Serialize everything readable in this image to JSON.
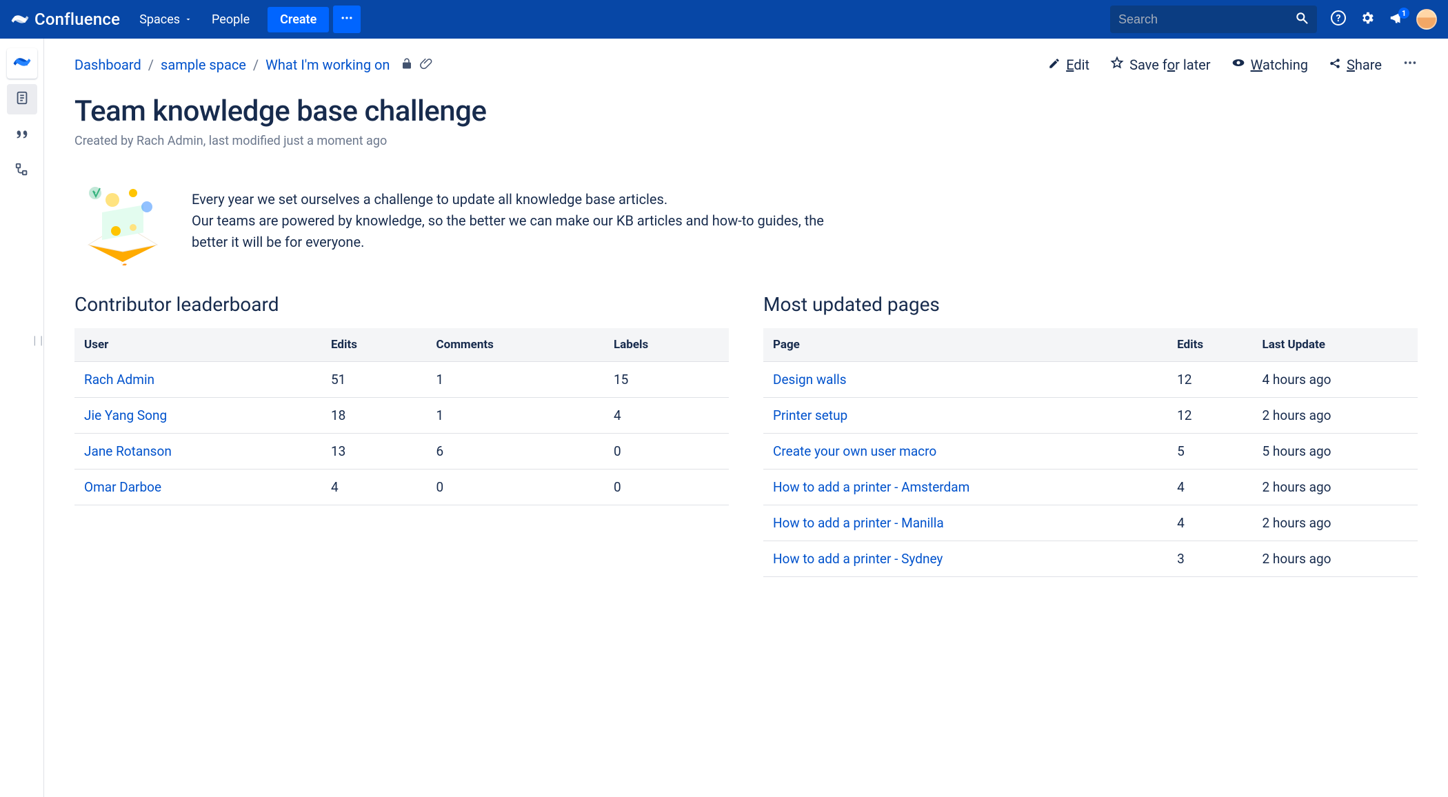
{
  "header": {
    "product": "Confluence",
    "nav": {
      "spaces": "Spaces",
      "people": "People"
    },
    "create": "Create",
    "search_placeholder": "Search",
    "notif_count": "1"
  },
  "breadcrumb": {
    "items": [
      "Dashboard",
      "sample space",
      "What I'm working on"
    ]
  },
  "page_actions": {
    "edit": "Edit",
    "save": "Save for later",
    "watching": "Watching",
    "share": "Share"
  },
  "page": {
    "title": "Team knowledge base challenge",
    "byline": "Created by Rach Admin, last modified just a moment ago",
    "intro_l1": "Every year we set ourselves a challenge to update all knowledge base articles.",
    "intro_l2": "Our teams are powered by knowledge, so the better we can make our KB articles and how-to guides, the better it will be for everyone."
  },
  "leaderboard": {
    "title": "Contributor leaderboard",
    "cols": {
      "user": "User",
      "edits": "Edits",
      "comments": "Comments",
      "labels": "Labels"
    },
    "rows": [
      {
        "user": "Rach Admin",
        "edits": "51",
        "comments": "1",
        "labels": "15"
      },
      {
        "user": "Jie Yang Song",
        "edits": "18",
        "comments": "1",
        "labels": "4"
      },
      {
        "user": "Jane Rotanson",
        "edits": "13",
        "comments": "6",
        "labels": "0"
      },
      {
        "user": "Omar Darboe",
        "edits": "4",
        "comments": "0",
        "labels": "0"
      }
    ]
  },
  "updated": {
    "title": "Most updated pages",
    "cols": {
      "page": "Page",
      "edits": "Edits",
      "last": "Last Update"
    },
    "rows": [
      {
        "page": "Design walls",
        "edits": "12",
        "last": "4 hours ago"
      },
      {
        "page": "Printer setup",
        "edits": "12",
        "last": "2 hours ago"
      },
      {
        "page": "Create your own user macro",
        "edits": "5",
        "last": "5 hours ago"
      },
      {
        "page": "How to add a printer - Amsterdam",
        "edits": "4",
        "last": "2 hours ago"
      },
      {
        "page": "How to add a printer - Manilla",
        "edits": "4",
        "last": "2 hours ago"
      },
      {
        "page": "How to add a printer - Sydney",
        "edits": "3",
        "last": "2 hours ago"
      }
    ]
  }
}
